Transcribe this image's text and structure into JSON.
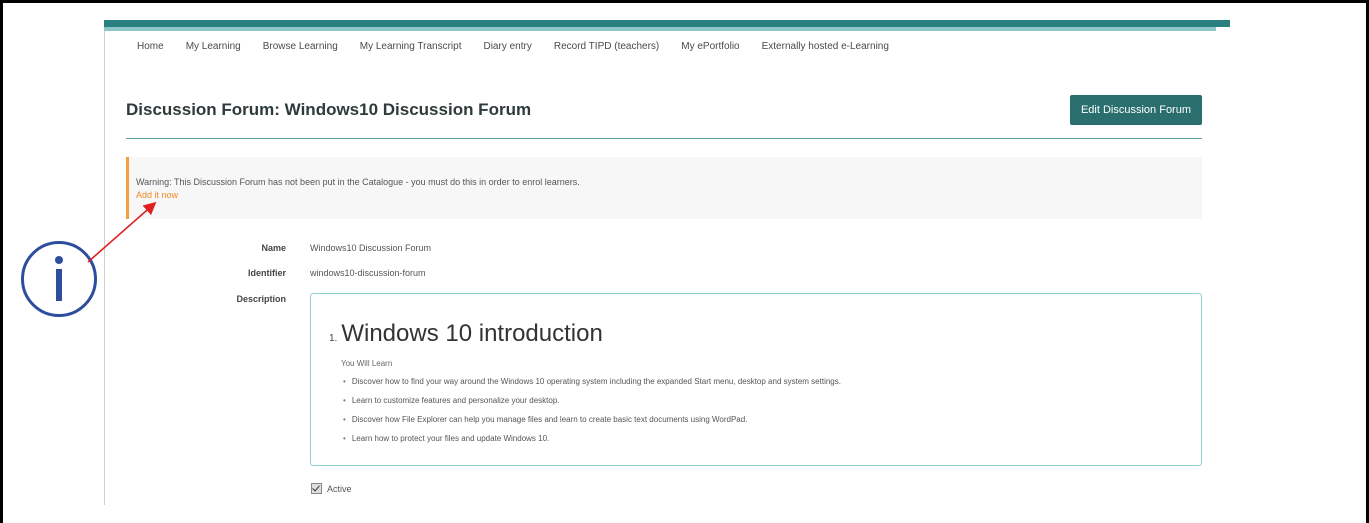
{
  "nav": {
    "items": [
      "Home",
      "My Learning",
      "Browse Learning",
      "My Learning Transcript",
      "Diary entry",
      "Record TIPD (teachers)",
      "My ePortfolio",
      "Externally hosted e-Learning"
    ]
  },
  "page": {
    "title": "Discussion Forum: Windows10 Discussion Forum",
    "edit_button": "Edit Discussion Forum"
  },
  "warning": {
    "text": "Warning: This Discussion Forum has not been put in the Catalogue - you must do this in order to enrol learners.",
    "link": "Add it now"
  },
  "details": {
    "name_label": "Name",
    "name_value": "Windows10 Discussion Forum",
    "identifier_label": "Identifier",
    "identifier_value": "windows10-discussion-forum",
    "description_label": "Description"
  },
  "description": {
    "number": "1.",
    "heading": "Windows 10 introduction",
    "intro": "You Will Learn",
    "bullets": [
      "Discover how to find your way around the Windows 10 operating system including the expanded Start menu, desktop and system settings.",
      "Learn to customize features and personalize your desktop.",
      "Discover how File Explorer can help you manage files and learn to create basic text documents using WordPad.",
      "Learn how to protect your files and update Windows 10."
    ]
  },
  "active": {
    "label": "Active",
    "checked": true
  },
  "colors": {
    "accent_teal": "#2b6e6e",
    "warning_orange": "#f08a24",
    "annotation_blue": "#2e4d9c",
    "annotation_red": "#e02020"
  }
}
